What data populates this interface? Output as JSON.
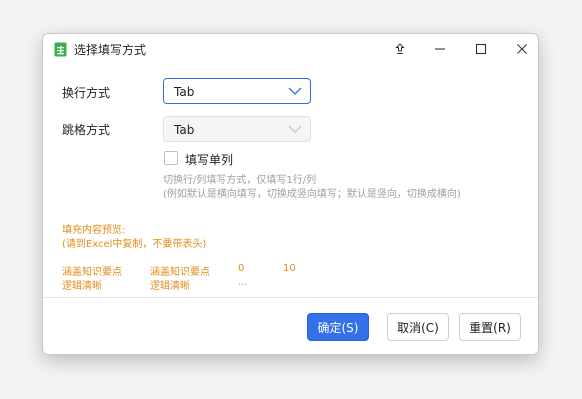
{
  "window": {
    "title": "选择填写方式",
    "icon": "spreadsheet-icon"
  },
  "form": {
    "wrap_label": "换行方式",
    "wrap_value": "Tab",
    "cell_label": "跳格方式",
    "cell_value": "Tab",
    "single_col_label": "填写单列",
    "single_col_checked": false,
    "hint_line1": "切换行/列填写方式，仅填写1行/列",
    "hint_line2": "(例如默认是横向填写，切换成竖向填写；默认是竖向，切换成横向)"
  },
  "preview": {
    "title_line1": "填充内容预览:",
    "title_line2": "(请到Excel中复制，不要带表头)",
    "rows": [
      [
        "涵盖知识要点",
        "涵盖知识要点",
        "0",
        "10"
      ],
      [
        "逻辑清晰",
        "逻辑清晰",
        "..."
      ]
    ]
  },
  "buttons": {
    "ok": "确定(S)",
    "cancel": "取消(C)",
    "reset": "重置(R)"
  },
  "colors": {
    "accent": "#3271ea",
    "preview_text": "#e38c1b",
    "hint_text": "#a0a0a0"
  }
}
